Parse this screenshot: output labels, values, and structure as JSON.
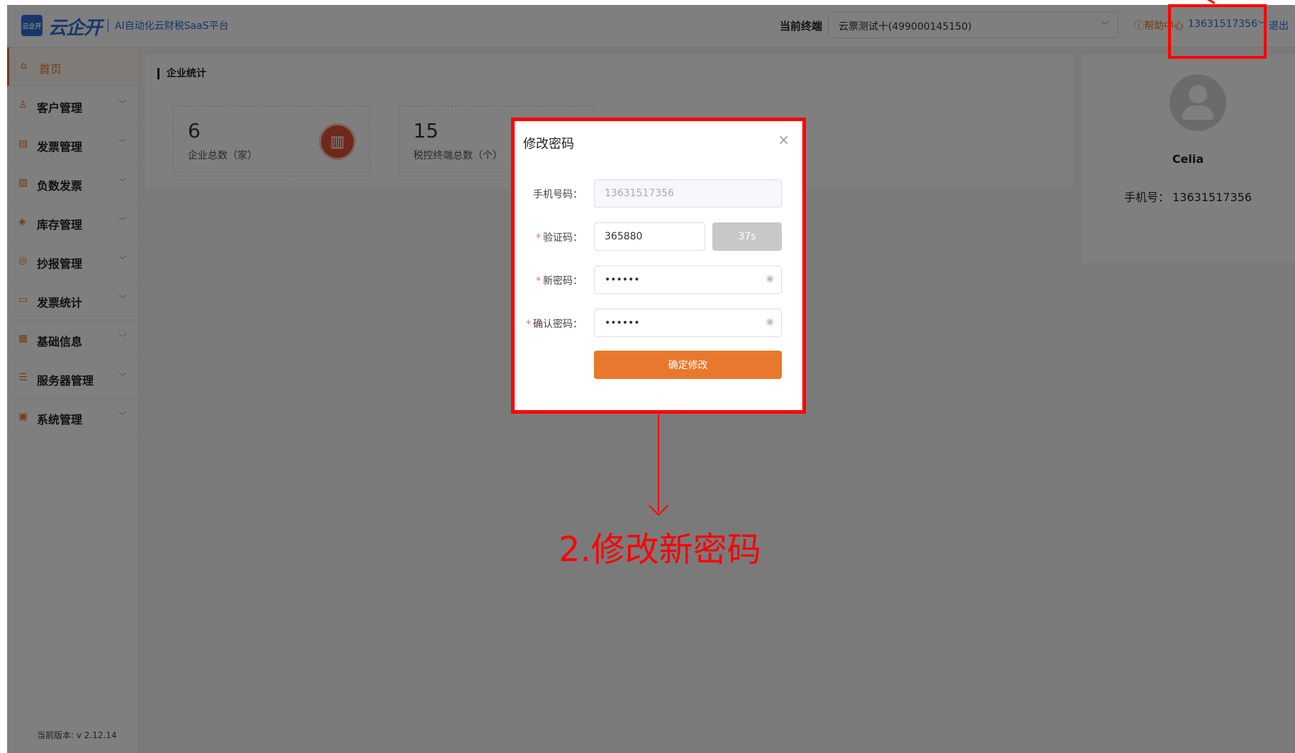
{
  "header": {
    "logo_box_text": "云企开",
    "logo_text": "云企开",
    "slogan": "AI自动化云财税SaaS平台",
    "terminal_label": "当前终端",
    "terminal_value": "云票测试十(499000145150)",
    "help": "ⓘ帮助中心",
    "user_phone": "13631517356",
    "logout": "退出"
  },
  "sidebar": {
    "items": [
      {
        "label": "首页",
        "icon": "home-icon"
      },
      {
        "label": "客户管理",
        "icon": "customers-icon"
      },
      {
        "label": "发票管理",
        "icon": "invoice-icon"
      },
      {
        "label": "负数发票",
        "icon": "negative-invoice-icon"
      },
      {
        "label": "库存管理",
        "icon": "inventory-icon"
      },
      {
        "label": "抄报管理",
        "icon": "report-icon"
      },
      {
        "label": "发票统计",
        "icon": "statistics-icon"
      },
      {
        "label": "基础信息",
        "icon": "grid-icon"
      },
      {
        "label": "服务器管理",
        "icon": "server-icon"
      },
      {
        "label": "系统管理",
        "icon": "system-icon"
      }
    ],
    "version": "当前版本: v 2.12.14"
  },
  "stats": {
    "title": "企业统计",
    "cards": [
      {
        "value": "6",
        "caption": "企业总数（家）"
      },
      {
        "value": "15",
        "caption": "税控终端总数（个）"
      }
    ]
  },
  "profile": {
    "name": "Celia",
    "phone_label": "手机号：",
    "phone": "13631517356"
  },
  "modal": {
    "title": "修改密码",
    "fields": {
      "phone_label": "手机号码：",
      "phone_value": "13631517356",
      "code_label": "验证码：",
      "code_value": "365880",
      "code_button": "37s",
      "new_pwd_label": "新密码：",
      "new_pwd_value": "••••••",
      "confirm_pwd_label": "确认密码：",
      "confirm_pwd_value": "••••••"
    },
    "submit": "确定修改"
  },
  "annotation": {
    "text": "2.修改新密码",
    "color": "#ff0000"
  },
  "colors": {
    "accent": "#e8782d",
    "brand": "#2f6fd6"
  }
}
